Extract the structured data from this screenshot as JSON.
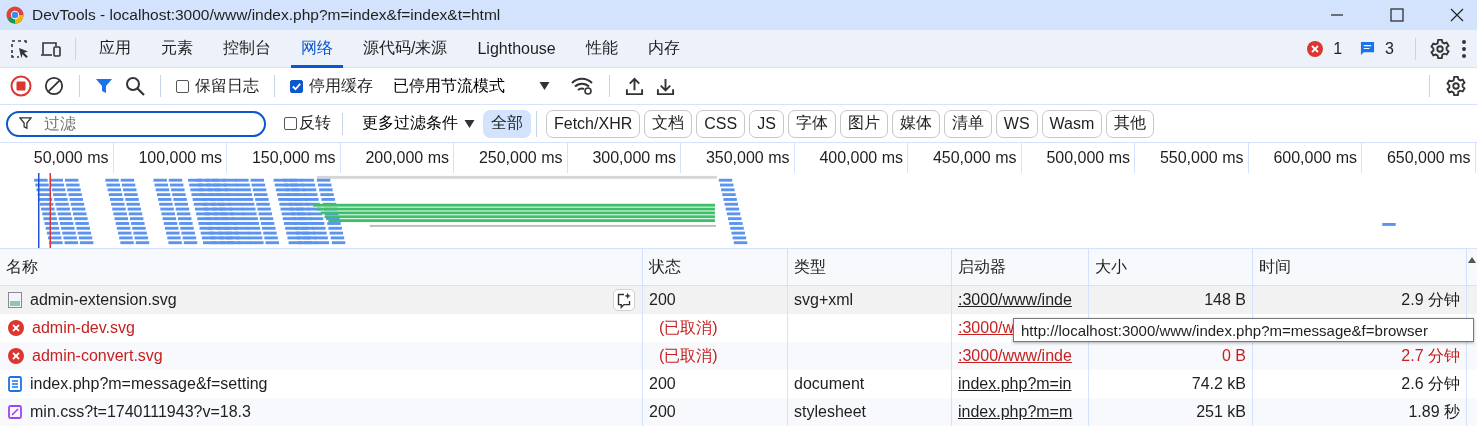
{
  "window": {
    "title": "DevTools - localhost:3000/www/index.php?m=index&f=index&t=html"
  },
  "tabs": [
    {
      "label": "应用",
      "selected": false
    },
    {
      "label": "元素",
      "selected": false
    },
    {
      "label": "控制台",
      "selected": false
    },
    {
      "label": "网络",
      "selected": true
    },
    {
      "label": "源代码/来源",
      "selected": false
    },
    {
      "label": "Lighthouse",
      "selected": false
    },
    {
      "label": "性能",
      "selected": false
    },
    {
      "label": "内存",
      "selected": false
    }
  ],
  "badges": {
    "errors": "1",
    "messages": "3"
  },
  "toolbar": {
    "recording": true,
    "preserve_log": {
      "label": "保留日志",
      "checked": false
    },
    "disable_cache": {
      "label": "停用缓存",
      "checked": true
    },
    "throttling": "已停用节流模式"
  },
  "filter": {
    "placeholder": "过滤",
    "invert": {
      "label": "反转",
      "checked": false
    },
    "more_filters": "更多过滤条件",
    "types": [
      {
        "label": "全部",
        "selected": true
      },
      {
        "label": "Fetch/XHR",
        "selected": false
      },
      {
        "label": "文档",
        "selected": false
      },
      {
        "label": "CSS",
        "selected": false
      },
      {
        "label": "JS",
        "selected": false
      },
      {
        "label": "字体",
        "selected": false
      },
      {
        "label": "图片",
        "selected": false
      },
      {
        "label": "媒体",
        "selected": false
      },
      {
        "label": "清单",
        "selected": false
      },
      {
        "label": "WS",
        "selected": false
      },
      {
        "label": "Wasm",
        "selected": false
      },
      {
        "label": "其他",
        "selected": false
      }
    ]
  },
  "timeline": {
    "ticks": [
      "50,000 ms",
      "100,000 ms",
      "150,000 ms",
      "200,000 ms",
      "250,000 ms",
      "300,000 ms",
      "350,000 ms",
      "400,000 ms",
      "450,000 ms",
      "500,000 ms",
      "550,000 ms",
      "600,000 ms",
      "650,000 ms"
    ]
  },
  "table": {
    "columns": [
      "名称",
      "状态",
      "类型",
      "启动器",
      "大小",
      "时间"
    ],
    "rows": [
      {
        "kind": "image",
        "selected": true,
        "name": "admin-extension.svg",
        "status": "200",
        "type": "svg+xml",
        "initiator": ":3000/www/inde",
        "size": "148 B",
        "time": "2.9 分钟"
      },
      {
        "kind": "failed",
        "selected": false,
        "name": "admin-dev.svg",
        "status": "(已取消)",
        "initiator": ":3000/w"
      },
      {
        "kind": "failed",
        "selected": false,
        "name": "admin-convert.svg",
        "status": "(已取消)",
        "initiator": ":3000/www/inde",
        "size": "0 B",
        "time": "2.7 分钟"
      },
      {
        "kind": "document",
        "selected": false,
        "name": "index.php?m=message&f=setting",
        "status": "200",
        "type": "document",
        "initiator": "index.php?m=in",
        "size": "74.2 kB",
        "time": "2.6 分钟"
      },
      {
        "kind": "stylesheet",
        "selected": false,
        "name": "min.css?t=1740111943?v=18.3",
        "status": "200",
        "type": "stylesheet",
        "initiator": "index.php?m=m",
        "size": "251 kB",
        "time": "1.89 秒"
      }
    ]
  },
  "tooltip": "http://localhost:3000/www/index.php?m=message&f=browser"
}
